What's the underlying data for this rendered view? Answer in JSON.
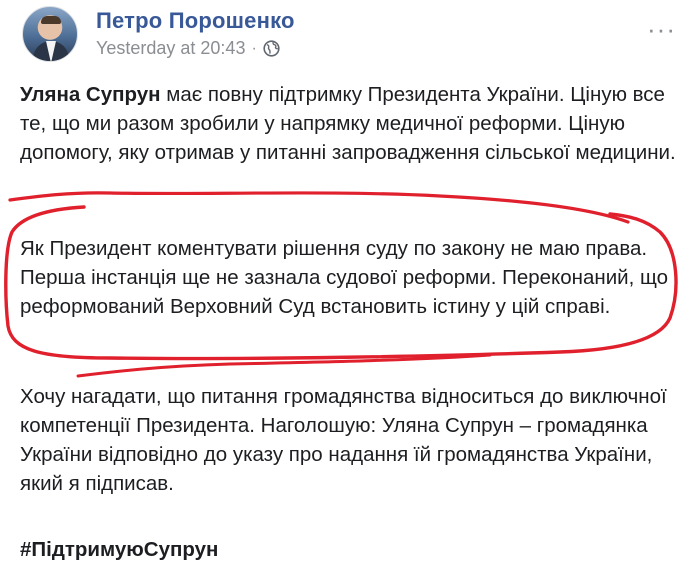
{
  "post": {
    "author": "Петро Порошенко",
    "timestamp": "Yesterday at 20:43",
    "separator": "·",
    "privacy_icon": "globe-icon",
    "more_icon": "more-options-icon",
    "more_label": "···",
    "paragraphs": [
      {
        "name": "Уляна Супрун",
        "text": " має повну підтримку Президента України. Ціную все те, що ми разом зробили у напрямку медичної реформи. Ціную допомогу, яку отримав у питанні запровадження сільської медицини."
      },
      {
        "text": "Як Президент коментувати рішення суду по закону не маю права. Перша інстанція ще не зазнала судової реформи. Переконаний, що реформований Верховний Суд встановить істину у цій справі."
      },
      {
        "text": "Хочу нагадати, що питання громадянства відноситься до виключної компетенції Президента. Наголошую: Уляна Супрун – громадянка України відповідно до указу про надання їй громадянства України, який я підписав."
      },
      {
        "text": "#ПідтримуюСупрун"
      }
    ]
  },
  "colors": {
    "author": "#385898",
    "meta": "#8a8d91",
    "text": "#1c1e21",
    "annotation": "#e0202c"
  }
}
